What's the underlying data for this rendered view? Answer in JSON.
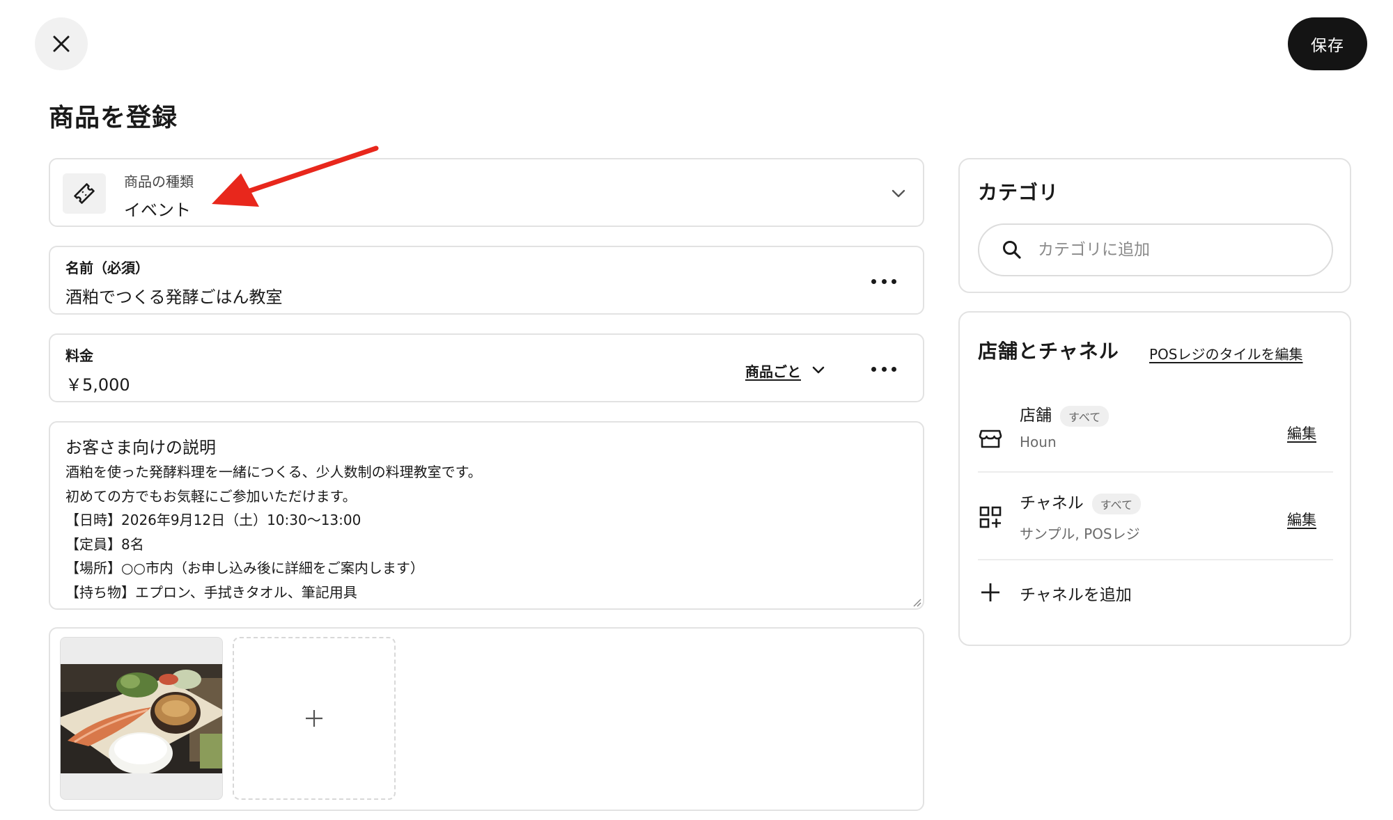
{
  "header": {
    "save_label": "保存",
    "title": "商品を登録"
  },
  "product_type": {
    "label": "商品の種類",
    "value": "イベント"
  },
  "name_field": {
    "label": "名前（必須）",
    "value": "酒粕でつくる発酵ごはん教室"
  },
  "price_field": {
    "label": "料金",
    "value": "￥5,000",
    "mode_label": "商品ごと"
  },
  "description_field": {
    "label": "お客さま向けの説明",
    "value": "酒粕を使った発酵料理を一緒につくる、少人数制の料理教室です。\n初めての方でもお気軽にご参加いただけます。\n【日時】2026年9月12日（土）10:30〜13:00\n【定員】8名\n【場所】○○市内（お申し込み後に詳細をご案内します）\n【持ち物】エプロン、手拭きタオル、筆記用具"
  },
  "category": {
    "title": "カテゴリ",
    "search_placeholder": "カテゴリに追加"
  },
  "stores_channels": {
    "title": "店舗とチャネル",
    "pos_link": "POSレジのタイルを編集",
    "rows": [
      {
        "name": "店舗",
        "badge": "すべて",
        "sub": "Houn",
        "edit": "編集"
      },
      {
        "name": "チャネル",
        "badge": "すべて",
        "sub": "サンプル, POSレジ",
        "edit": "編集"
      }
    ],
    "add_channel": "チャネルを追加"
  },
  "colors": {
    "annotation_arrow": "#e8271c",
    "save_button_bg": "#141414"
  },
  "icons": [
    "close-icon",
    "ticket-icon",
    "chevron-down-icon",
    "more-icon",
    "search-icon",
    "store-icon",
    "apps-add-icon",
    "plus-icon"
  ]
}
